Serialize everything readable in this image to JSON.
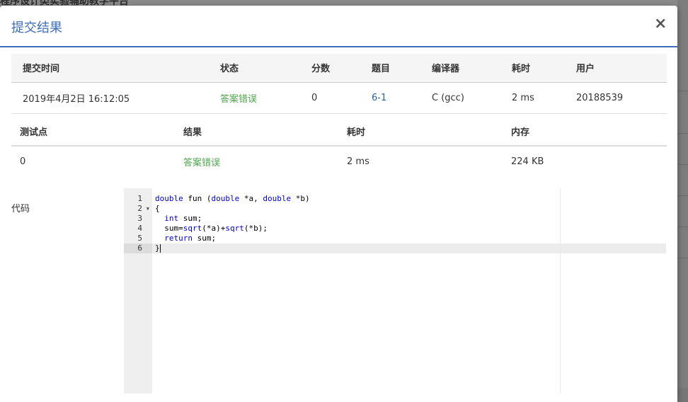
{
  "background": {
    "title": "程序设计类实验辅助教学平台"
  },
  "modal": {
    "title": "提交结果",
    "close_label": "×"
  },
  "summary": {
    "headers": [
      "提交时间",
      "状态",
      "分数",
      "题目",
      "编译器",
      "耗时",
      "用户"
    ],
    "row": {
      "time": "2019年4月2日 16:12:05",
      "status": "答案错误",
      "score": "0",
      "problem": "6-1",
      "compiler": "C (gcc)",
      "elapsed": "2 ms",
      "user": "20188539"
    }
  },
  "testcases": {
    "headers": [
      "测试点",
      "结果",
      "耗时",
      "内存"
    ],
    "rows": [
      {
        "id": "0",
        "result": "答案错误",
        "elapsed": "2 ms",
        "memory": "224 KB"
      }
    ]
  },
  "code": {
    "label": "代码",
    "line_numbers": [
      "1",
      "2",
      "3",
      "4",
      "5",
      "6"
    ],
    "lines": [
      "double fun (double *a, double *b)",
      "{",
      "  int sum;",
      "  sum=sqrt(*a)+sqrt(*b);",
      "  return sum;",
      "}"
    ]
  },
  "colors": {
    "accent": "#3e6eb8",
    "status_error": "#4ea54e",
    "link": "#2d5f9a"
  }
}
